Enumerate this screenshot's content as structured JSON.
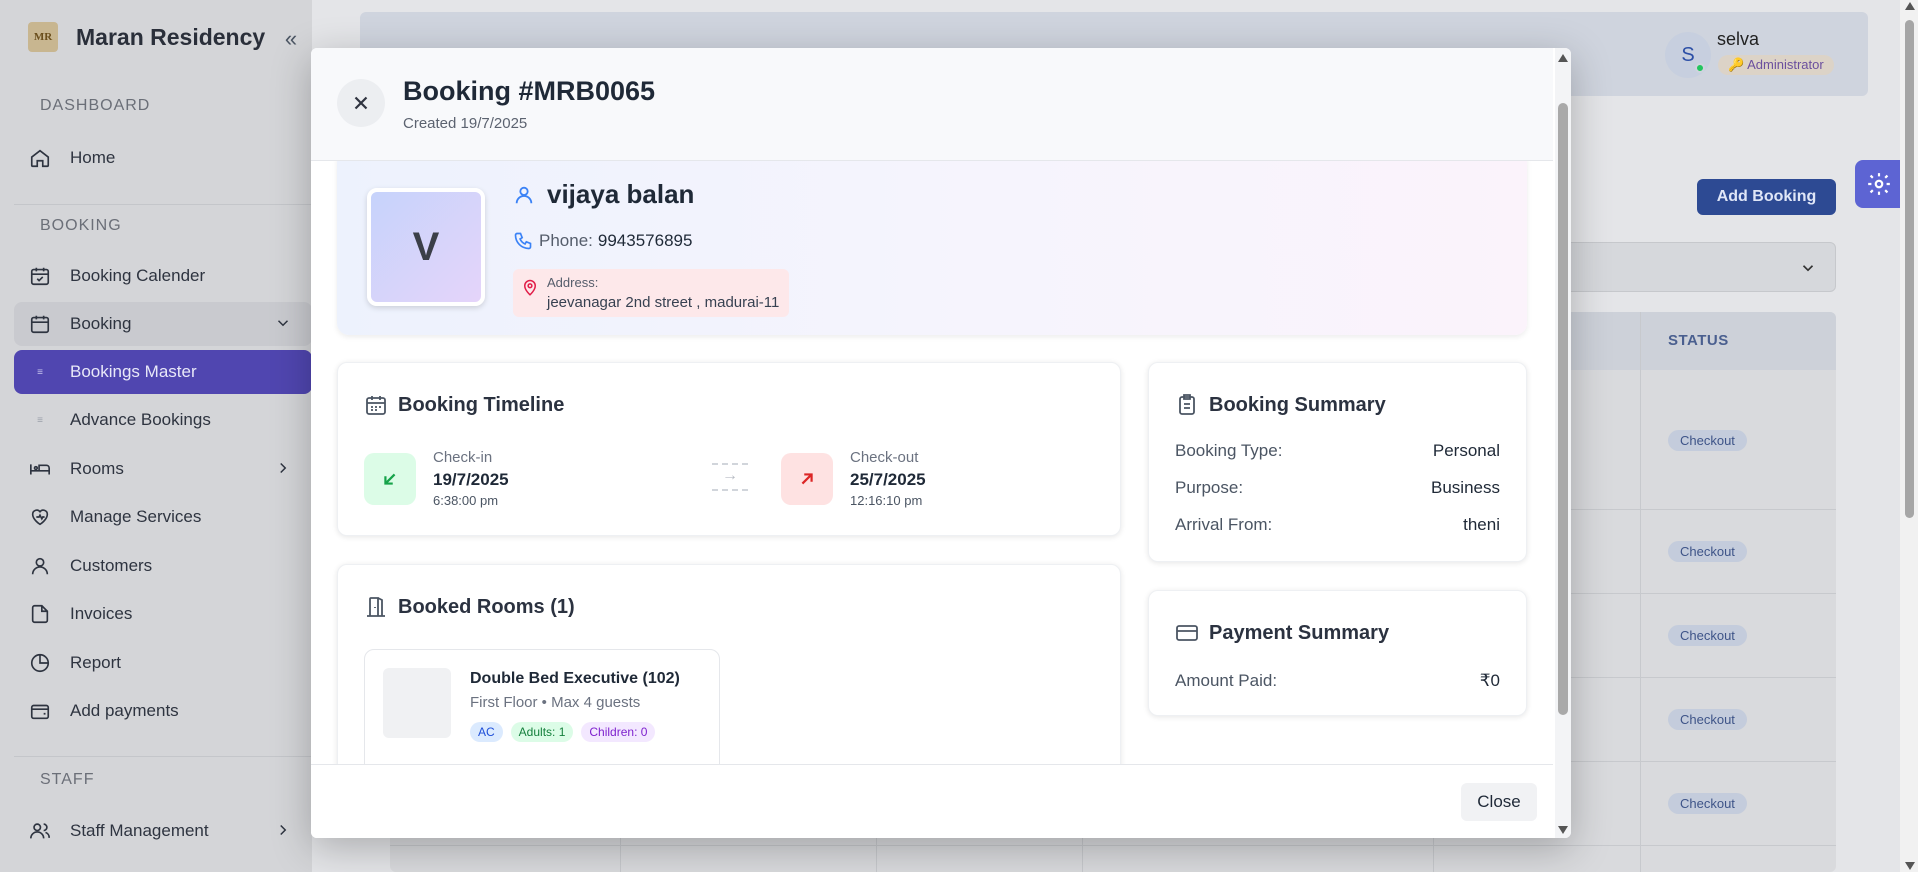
{
  "brand": {
    "name": "Maran Residency",
    "logo_text": "MR"
  },
  "sidebar": {
    "sections": [
      {
        "label": "DASHBOARD"
      },
      {
        "label": "BOOKING"
      },
      {
        "label": "STAFF"
      }
    ],
    "items": [
      {
        "label": "Home",
        "icon": "home-icon"
      },
      {
        "label": "Booking Calender",
        "icon": "calendar-icon"
      },
      {
        "label": "Booking",
        "icon": "calendar-icon",
        "expanded": true
      },
      {
        "label": "Bookings Master",
        "active": true
      },
      {
        "label": "Advance Bookings"
      },
      {
        "label": "Rooms",
        "icon": "bed-icon"
      },
      {
        "label": "Manage Services",
        "icon": "heart-icon"
      },
      {
        "label": "Customers",
        "icon": "user-icon"
      },
      {
        "label": "Invoices",
        "icon": "file-icon"
      },
      {
        "label": "Report",
        "icon": "chart-icon"
      },
      {
        "label": "Add payments",
        "icon": "wallet-icon"
      },
      {
        "label": "Staff Management",
        "icon": "users-icon"
      }
    ]
  },
  "header": {
    "user": {
      "initial": "S",
      "name": "selva",
      "role": "Administrator",
      "role_icon": "🔑"
    }
  },
  "page": {
    "add_booking_label": "Add Booking",
    "table": {
      "status_header": "STATUS",
      "statuses": [
        "Checkout",
        "Checkout",
        "Checkout",
        "Checkout",
        "Checkout"
      ]
    }
  },
  "modal": {
    "title": "Booking #MRB0065",
    "created": "Created 19/7/2025",
    "guest": {
      "initial": "V",
      "name": "vijaya balan",
      "phone_label": "Phone:",
      "phone": "9943576895",
      "address_label": "Address:",
      "address": "jeevanagar 2nd street , madurai-11"
    },
    "timeline": {
      "title": "Booking Timeline",
      "checkin_label": "Check-in",
      "checkin_date": "19/7/2025",
      "checkin_time": "6:38:00 pm",
      "checkout_label": "Check-out",
      "checkout_date": "25/7/2025",
      "checkout_time": "12:16:10 pm",
      "connector": "→"
    },
    "rooms": {
      "title": "Booked Rooms (1)",
      "items": [
        {
          "name": "Double Bed Executive (102)",
          "meta": "First Floor • Max 4 guests",
          "tags": [
            "AC",
            "Adults: 1",
            "Children: 0"
          ]
        }
      ]
    },
    "booking_summary": {
      "title": "Booking Summary",
      "rows": [
        {
          "key": "Booking Type:",
          "value": "Personal"
        },
        {
          "key": "Purpose:",
          "value": "Business"
        },
        {
          "key": "Arrival From:",
          "value": "theni"
        }
      ]
    },
    "payment_summary": {
      "title": "Payment Summary",
      "rows": [
        {
          "key": "Amount Paid:",
          "value": "₹0"
        }
      ]
    },
    "close_label": "Close"
  },
  "colors": {
    "accent": "#5046b0",
    "primary_button": "#2d4a93",
    "checkin_green": "#16a34a",
    "checkout_red": "#dc2626"
  }
}
